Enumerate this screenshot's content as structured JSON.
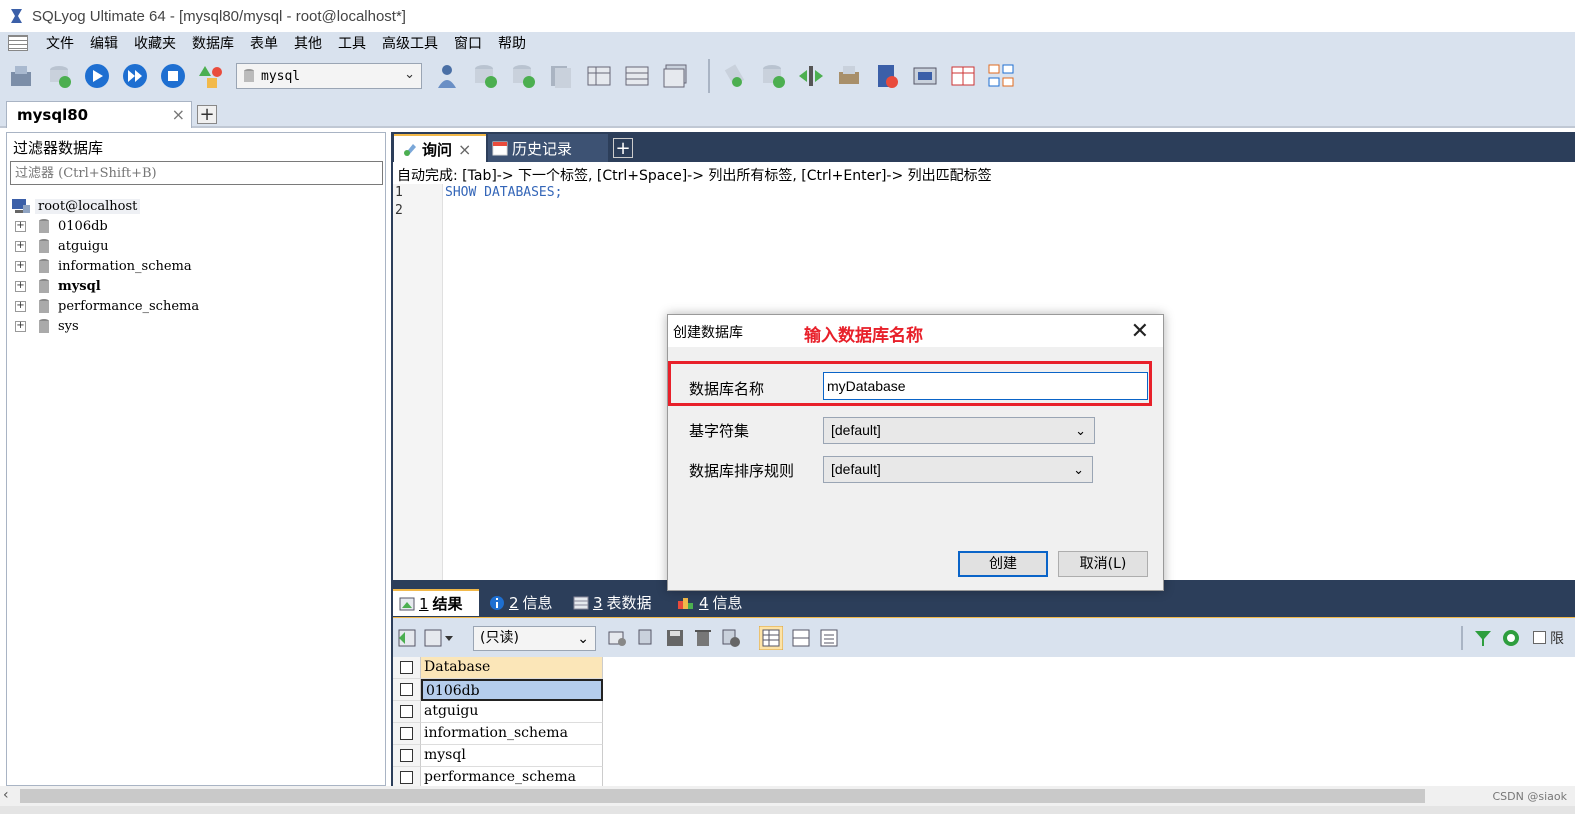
{
  "window": {
    "title": "SQLyog Ultimate 64 - [mysql80/mysql - root@localhost*]"
  },
  "menu": [
    "文件",
    "编辑",
    "收藏夹",
    "数据库",
    "表单",
    "其他",
    "工具",
    "高级工具",
    "窗口",
    "帮助"
  ],
  "toolbar": {
    "db_select_value": "mysql"
  },
  "connection_tab": {
    "label": "mysql80",
    "close": "×",
    "add": "+"
  },
  "left_panel": {
    "header": "过滤器数据库",
    "filter_placeholder": "过滤器 (Ctrl+Shift+B)",
    "root": "root@localhost",
    "databases": [
      {
        "name": "0106db",
        "bold": false
      },
      {
        "name": "atguigu",
        "bold": false
      },
      {
        "name": "information_schema",
        "bold": false
      },
      {
        "name": "mysql",
        "bold": true
      },
      {
        "name": "performance_schema",
        "bold": false
      },
      {
        "name": "sys",
        "bold": false
      }
    ]
  },
  "query_tabs": {
    "query": "询问",
    "history": "历史记录",
    "close": "×",
    "add": "+"
  },
  "editor": {
    "autocomplete_hint": "自动完成: [Tab]-> 下一个标签, [Ctrl+Space]-> 列出所有标签, [Ctrl+Enter]-> 列出匹配标签",
    "line_numbers": [
      "1",
      "2"
    ],
    "line1": "SHOW DATABASES;"
  },
  "result_tabs": [
    {
      "num": "1",
      "label": "结果"
    },
    {
      "num": "2",
      "label": "信息"
    },
    {
      "num": "3",
      "label": "表数据"
    },
    {
      "num": "4",
      "label": "信息"
    }
  ],
  "result_toolbar": {
    "readonly_select": "(只读)",
    "limit_label": "限"
  },
  "grid": {
    "header": "Database",
    "rows": [
      "0106db",
      "atguigu",
      "information_schema",
      "mysql",
      "performance_schema"
    ],
    "selected_row": "0106db"
  },
  "dialog": {
    "title": "创建数据库",
    "annotation": "输入数据库名称",
    "close": "✕",
    "name_label": "数据库名称",
    "name_value": "myDatabase",
    "charset_label": "基字符集",
    "charset_value": "[default]",
    "collation_label": "数据库排序规则",
    "collation_value": "[default]",
    "create_button": "创建",
    "cancel_button": "取消(L)"
  },
  "watermark": "CSDN @siaok",
  "colors": {
    "accent_red": "#e8202a",
    "dark_panel": "#2c3e5a",
    "tab_highlight": "#f2b94a"
  }
}
